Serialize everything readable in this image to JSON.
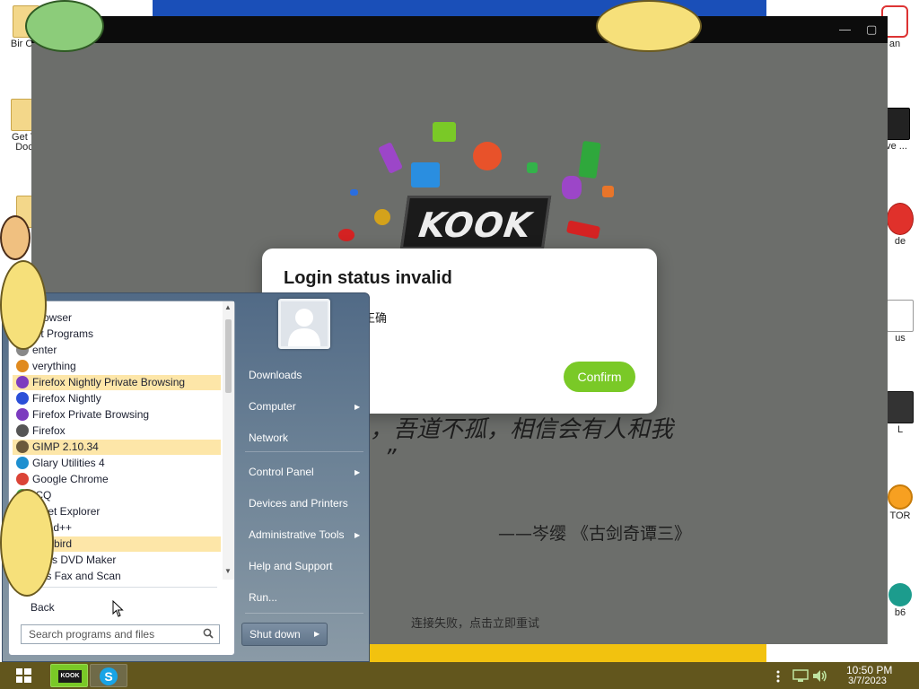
{
  "desktop": {
    "icons": [
      {
        "label": "Bir Cra"
      },
      {
        "label": "Get Y Doc"
      },
      {
        "label": "an"
      },
      {
        "label": "ve ..."
      },
      {
        "label": "de"
      },
      {
        "label": "us"
      },
      {
        "label": "L"
      },
      {
        "label": "TOR"
      },
      {
        "label": "b6"
      }
    ]
  },
  "kook": {
    "logo_text": "KOOK",
    "quote_line1": "，吾道不孤，相信会有人和我",
    "quote_line2": "”",
    "quote_author": "——岑缨 《古剑奇谭三》",
    "retry_text": "连接失败，点击立即重试",
    "window_controls": {
      "minimize": "—",
      "maximize": "▢"
    }
  },
  "dialog": {
    "title": "Login status invalid",
    "message": "正确",
    "confirm_label": "Confirm",
    "accent_color": "#7ac927"
  },
  "start_menu": {
    "programs": [
      {
        "label": "Browser",
        "icon": "browser-icon",
        "highlighted": false
      },
      {
        "label": "ult Programs",
        "icon": "default-programs-icon",
        "highlighted": false
      },
      {
        "label": "enter",
        "icon": "center-icon",
        "highlighted": false
      },
      {
        "label": "verything",
        "icon": "everything-icon",
        "highlighted": false
      },
      {
        "label": "Firefox Nightly Private Browsing",
        "icon": "firefox-private-icon",
        "highlighted": true
      },
      {
        "label": "Firefox Nightly",
        "icon": "firefox-nightly-icon",
        "highlighted": false
      },
      {
        "label": "Firefox Private Browsing",
        "icon": "firefox-private-icon",
        "highlighted": false
      },
      {
        "label": "Firefox",
        "icon": "firefox-icon",
        "highlighted": false
      },
      {
        "label": "GIMP 2.10.34",
        "icon": "gimp-icon",
        "highlighted": true
      },
      {
        "label": "Glary Utilities 4",
        "icon": "glary-icon",
        "highlighted": false
      },
      {
        "label": "Google Chrome",
        "icon": "chrome-icon",
        "highlighted": false
      },
      {
        "label": "ICQ",
        "icon": "icq-icon",
        "highlighted": false
      },
      {
        "label": "ernet Explorer",
        "icon": "ie-icon",
        "highlighted": false
      },
      {
        "label": "tepad++",
        "icon": "notepad-icon",
        "highlighted": false
      },
      {
        "label": "nderbird",
        "icon": "thunderbird-icon",
        "highlighted": true
      },
      {
        "label": "dows DVD Maker",
        "icon": "dvd-icon",
        "highlighted": false
      },
      {
        "label": "ows Fax and Scan",
        "icon": "fax-icon",
        "highlighted": false
      }
    ],
    "back_label": "Back",
    "search_placeholder": "Search programs and files",
    "right_items": [
      {
        "label": "Downloads",
        "submenu": false
      },
      {
        "label": "Computer",
        "submenu": true
      },
      {
        "label": "Network",
        "submenu": false
      },
      {
        "label": "Control Panel",
        "submenu": true
      },
      {
        "label": "Devices and Printers",
        "submenu": false
      },
      {
        "label": "Administrative Tools",
        "submenu": true
      },
      {
        "label": "Help and Support",
        "submenu": false
      },
      {
        "label": "Run...",
        "submenu": false
      }
    ],
    "shutdown_label": "Shut down"
  },
  "taskbar": {
    "kook_label": "KOOK",
    "skype_label": "S",
    "time": "10:50 PM",
    "date": "3/7/2023"
  }
}
